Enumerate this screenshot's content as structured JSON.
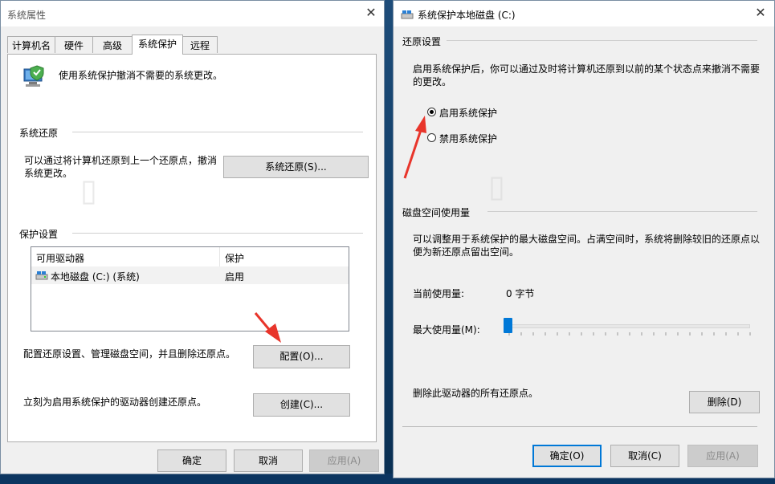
{
  "left_window": {
    "title": "系统属性",
    "tabs": [
      "计算机名",
      "硬件",
      "高级",
      "系统保护",
      "远程"
    ],
    "active_tab": "系统保护",
    "intro_text": "使用系统保护撤消不需要的系统更改。",
    "restore_group": {
      "label": "系统还原",
      "description": "可以通过将计算机还原到上一个还原点，撤消系统更改。",
      "button": "系统还原(S)..."
    },
    "protection_group": {
      "label": "保护设置",
      "columns": [
        "可用驱动器",
        "保护"
      ],
      "rows": [
        {
          "drive": "本地磁盘 (C:) (系统)",
          "protection": "启用"
        }
      ],
      "configure_text": "配置还原设置、管理磁盘空间，并且删除还原点。",
      "configure_button": "配置(O)...",
      "create_text": "立刻为启用系统保护的驱动器创建还原点。",
      "create_button": "创建(C)..."
    },
    "buttons": {
      "ok": "确定",
      "cancel": "取消",
      "apply": "应用(A)"
    }
  },
  "right_window": {
    "title": "系统保护本地磁盘 (C:)",
    "restore_settings": {
      "label": "还原设置",
      "description": "启用系统保护后，你可以通过及时将计算机还原到以前的某个状态点来撤消不需要的更改。",
      "options": [
        {
          "label": "启用系统保护",
          "selected": true
        },
        {
          "label": "禁用系统保护",
          "selected": false
        }
      ]
    },
    "disk_usage": {
      "label": "磁盘空间使用量",
      "description": "可以调整用于系统保护的最大磁盘空间。占满空间时，系统将删除较旧的还原点以便为新还原点留出空间。",
      "current_label": "当前使用量:",
      "current_value": "0 字节",
      "max_label": "最大使用量(M):",
      "max_usage_percent": 0
    },
    "delete_text": "删除此驱动器的所有还原点。",
    "delete_button": "删除(D)",
    "buttons": {
      "ok": "确定(O)",
      "cancel": "取消(C)",
      "apply": "应用(A)"
    }
  },
  "colors": {
    "arrow": "#e8352b",
    "accent": "#0078d7",
    "slider": "#0078d7"
  }
}
